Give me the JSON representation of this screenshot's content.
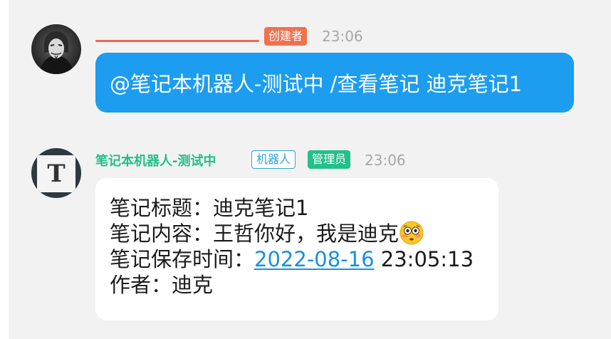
{
  "message_1": {
    "avatar_icon": "anonymous-mask-avatar-icon",
    "sender_name_redacted": true,
    "role_badge": "创建者",
    "time": "23:06",
    "text": "@笔记本机器人-测试中 /查看笔记 迪克笔记1",
    "bubble_color": "#1c9df0"
  },
  "message_2": {
    "avatar_icon": "typewriter-t-avatar-icon",
    "avatar_letter": "T",
    "sender_name": "笔记本机器人-测试中",
    "robot_badge": "机器人",
    "admin_badge": "管理员",
    "time": "23:06",
    "lines": {
      "title_label": "笔记标题：",
      "title_value": "迪克笔记1",
      "content_label": "笔记内容：",
      "content_value": "王哲你好，我是迪克",
      "content_emoji": "flushed-face-icon",
      "saved_label": "笔记保存时间：",
      "saved_date": "2022-08-16",
      "saved_time": " 23:05:13",
      "author_label": "作者：",
      "author_value": "迪克"
    }
  },
  "colors": {
    "chat_background": "#f2f2f2",
    "creator_badge": "#f0714e",
    "bot_name": "#22c08a",
    "robot_badge": "#2fa6d8",
    "admin_badge": "#22c08a",
    "link": "#1a8fe0",
    "timestamp": "#a7a7a7"
  }
}
